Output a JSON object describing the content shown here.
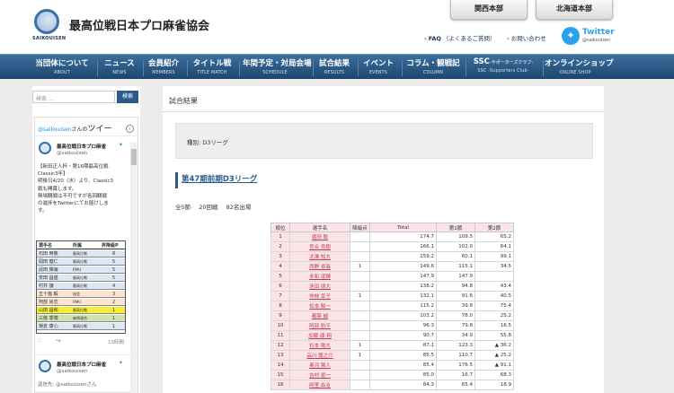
{
  "header": {
    "site_title": "最高位戦日本プロ麻雀協会",
    "logo_text": "SAIKOUISEN",
    "region_buttons": [
      "関西本部",
      "北海道本部"
    ],
    "faq_prefix": "FAQ",
    "faq_suffix": "（よくあるご質問）",
    "contact": "お問い合わせ",
    "twitter_label": "Twitter",
    "twitter_handle": "@saikouisen"
  },
  "nav": [
    {
      "jp": "当団体について",
      "en": "ABOUT"
    },
    {
      "jp": "ニュース",
      "en": "NEWS"
    },
    {
      "jp": "会員紹介",
      "en": "MEMBERS"
    },
    {
      "jp": "タイトル戦",
      "en": "TITLE MATCH"
    },
    {
      "jp": "年間予定・対局会場",
      "en": "SCHEDULE"
    },
    {
      "jp": "試合結果",
      "en": "RESULTS"
    },
    {
      "jp": "イベント",
      "en": "EVENTS"
    },
    {
      "jp": "コラム・観戦記",
      "en": "COLUMN"
    },
    {
      "jp": "SSC",
      "jp_small": "-サポーターズクラブ-",
      "en": "SSC -Supporters Club-"
    },
    {
      "jp": "オンラインショップ",
      "en": "ONLINE SHOP"
    }
  ],
  "sidebar": {
    "search_placeholder": "検索 ...",
    "search_button": "検索",
    "tw_header_handle": "@saikouisen",
    "tw_header_suffix": "さんの",
    "tw_header_tweets": "ツイー",
    "tw_name": "最高位戦日本プロ麻雀",
    "tw_handle": "@saikouisen",
    "tw_body": [
      "【新田正人杯・第16期最高位戦",
      "Classic3年】",
      "明後日4/20（水）より、Classic3",
      "戦も開幕します。",
      "無場観戦は不可ですが各回観戦",
      "の進捗をTwitterにてお届けしま",
      "す。"
    ],
    "rank_header": [
      "選手名",
      "所属",
      "昇降級P"
    ],
    "rank_rows": [
      {
        "name": "石田 時敬",
        "org": "最高位戦",
        "pts": "8"
      },
      {
        "name": "岡田 健仁",
        "org": "最高位戦",
        "pts": "5"
      },
      {
        "name": "武田 輝海",
        "org": "RMU",
        "pts": "5"
      },
      {
        "name": "安田 昌盛",
        "org": "最高位戦",
        "pts": "5"
      },
      {
        "name": "村井 謙",
        "org": "最高位戦",
        "pts": "4"
      },
      {
        "name": "五十嵐 毅",
        "org": "協会",
        "pts": "3"
      },
      {
        "name": "阿部 尚志",
        "org": "RMU",
        "pts": "2"
      },
      {
        "name": "山田 昌和",
        "org": "最高位戦",
        "pts": "1"
      },
      {
        "name": "三條 季博",
        "org": "麻将連合",
        "pts": "1"
      },
      {
        "name": "樋倉 康心",
        "org": "最高位戦",
        "pts": "1"
      }
    ],
    "tw_time": "13時間",
    "tw_name2": "最高位戦日本プロ麻雀",
    "tw_handle2": "@saikouisen",
    "tw_retweet": "返信先: @saikouisenさん"
  },
  "content": {
    "section_title": "試合結果",
    "league_label": "種別: D3リーグ",
    "league_link": "第47期前期D3リーグ",
    "summary": [
      "全5節",
      "20回戦",
      "82名出場"
    ],
    "table_headers": [
      "順位",
      "選手名",
      "降級点",
      "Total",
      "第1節",
      "第2節"
    ],
    "rows": [
      {
        "rank": "1",
        "name": "堀田 聡",
        "pen": "",
        "total": "174.7",
        "s1": "109.5",
        "s2": "65.2"
      },
      {
        "rank": "2",
        "name": "宮合 良樹",
        "pen": "",
        "total": "166.1",
        "s1": "102.0",
        "s2": "64.1"
      },
      {
        "rank": "3",
        "name": "北澤 知大",
        "pen": "",
        "total": "159.2",
        "s1": "60.1",
        "s2": "99.1"
      },
      {
        "rank": "4",
        "name": "西野 卓哉",
        "pen": "1",
        "total": "149.6",
        "s1": "115.1",
        "s2": "34.5"
      },
      {
        "rank": "5",
        "name": "多和 道輝",
        "pen": "",
        "total": "147.9",
        "s1": "147.9",
        "s2": ""
      },
      {
        "rank": "6",
        "name": "池田 朋大",
        "pen": "",
        "total": "138.2",
        "s1": "94.8",
        "s2": "43.4"
      },
      {
        "rank": "7",
        "name": "仲林 幸子",
        "pen": "1",
        "total": "132.1",
        "s1": "91.6",
        "s2": "40.5"
      },
      {
        "rank": "8",
        "name": "松本 駿一",
        "pen": "",
        "total": "115.2",
        "s1": "39.8",
        "s2": "75.4"
      },
      {
        "rank": "9",
        "name": "都築 誠",
        "pen": "",
        "total": "103.2",
        "s1": "78.0",
        "s2": "25.2"
      },
      {
        "rank": "10",
        "name": "阿部 航平",
        "pen": "",
        "total": "96.3",
        "s1": "79.8",
        "s2": "16.5"
      },
      {
        "rank": "11",
        "name": "加藤 康 翔",
        "pen": "",
        "total": "90.7",
        "s1": "34.9",
        "s2": "55.8"
      },
      {
        "rank": "12",
        "name": "杉本 陽大",
        "pen": "1",
        "total": "87.1",
        "s1": "123.3",
        "s2": "▲ 36.2"
      },
      {
        "rank": "13",
        "name": "品川 龍之介",
        "pen": "1",
        "total": "85.5",
        "s1": "110.7",
        "s2": "▲ 25.2"
      },
      {
        "rank": "14",
        "name": "奥河 賢人",
        "pen": "",
        "total": "85.4",
        "s1": "176.5",
        "s2": "▲ 91.1"
      },
      {
        "rank": "15",
        "name": "吉村 遊一",
        "pen": "",
        "total": "85.0",
        "s1": "16.7",
        "s2": "68.3"
      },
      {
        "rank": "16",
        "name": "岡里 ぬる",
        "pen": "",
        "total": "84.3",
        "s1": "65.4",
        "s2": "18.9"
      }
    ]
  }
}
